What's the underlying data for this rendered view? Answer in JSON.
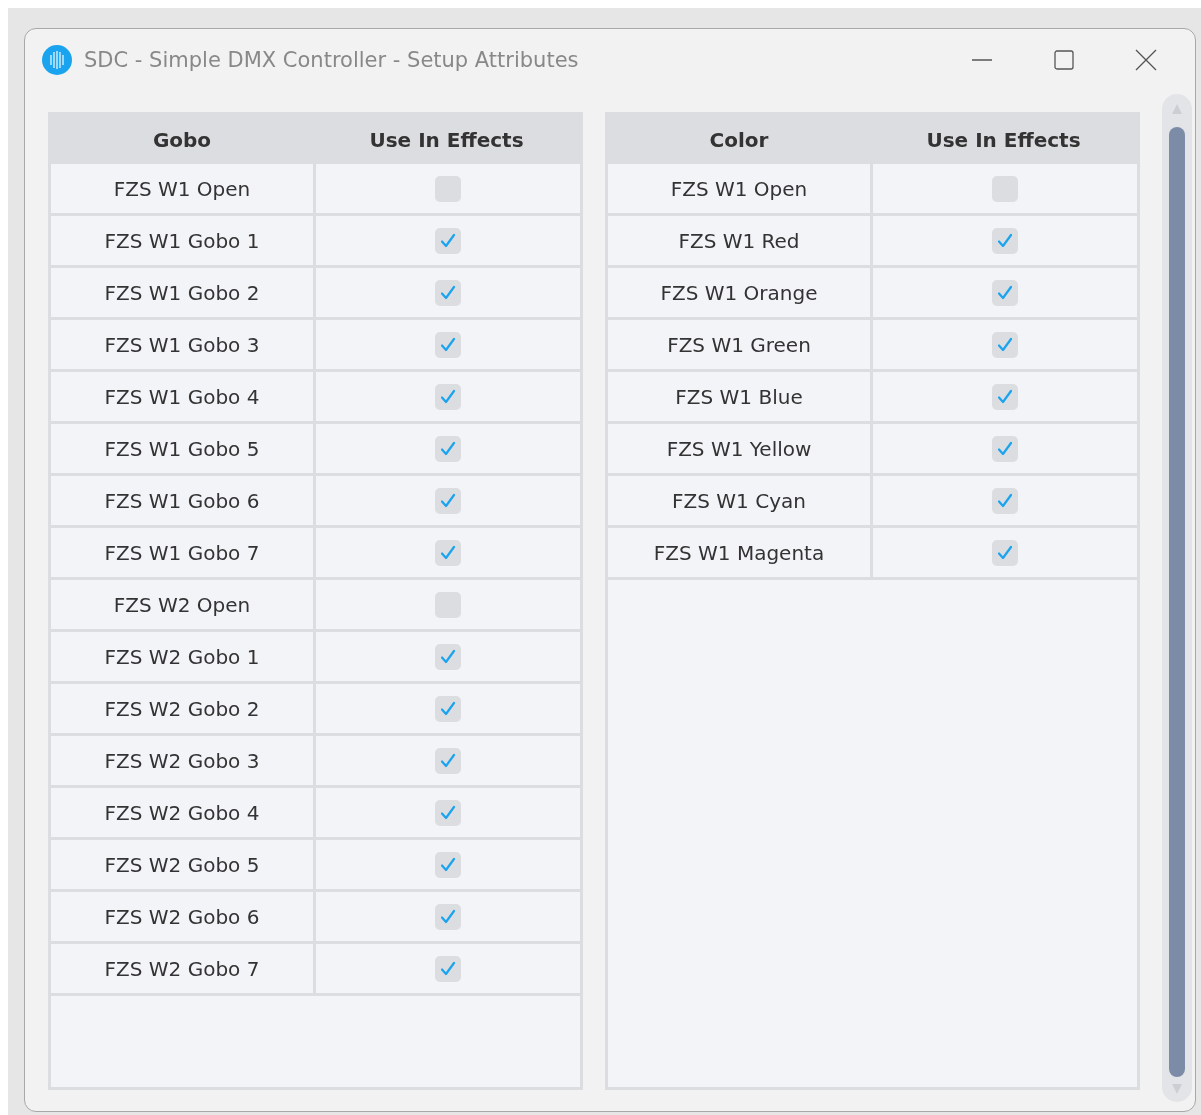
{
  "window": {
    "title": "SDC - Simple DMX Controller - Setup Attributes"
  },
  "tables": [
    {
      "columns": [
        "Gobo",
        "Use In Effects"
      ],
      "rows": [
        {
          "name": "FZS W1 Open",
          "checked": false
        },
        {
          "name": "FZS W1 Gobo 1",
          "checked": true
        },
        {
          "name": "FZS W1 Gobo 2",
          "checked": true
        },
        {
          "name": "FZS W1 Gobo 3",
          "checked": true
        },
        {
          "name": "FZS W1 Gobo 4",
          "checked": true
        },
        {
          "name": "FZS W1 Gobo 5",
          "checked": true
        },
        {
          "name": "FZS W1 Gobo 6",
          "checked": true
        },
        {
          "name": "FZS W1 Gobo 7",
          "checked": true
        },
        {
          "name": "FZS W2 Open",
          "checked": false
        },
        {
          "name": "FZS W2 Gobo 1",
          "checked": true
        },
        {
          "name": "FZS W2 Gobo 2",
          "checked": true
        },
        {
          "name": "FZS W2 Gobo 3",
          "checked": true
        },
        {
          "name": "FZS W2 Gobo 4",
          "checked": true
        },
        {
          "name": "FZS W2 Gobo 5",
          "checked": true
        },
        {
          "name": "FZS W2 Gobo 6",
          "checked": true
        },
        {
          "name": "FZS W2 Gobo 7",
          "checked": true
        }
      ]
    },
    {
      "columns": [
        "Color",
        "Use In Effects"
      ],
      "rows": [
        {
          "name": "FZS W1 Open",
          "checked": false
        },
        {
          "name": "FZS W1 Red",
          "checked": true
        },
        {
          "name": "FZS W1 Orange",
          "checked": true
        },
        {
          "name": "FZS W1 Green",
          "checked": true
        },
        {
          "name": "FZS W1 Blue",
          "checked": true
        },
        {
          "name": "FZS W1 Yellow",
          "checked": true
        },
        {
          "name": "FZS W1 Cyan",
          "checked": true
        },
        {
          "name": "FZS W1 Magenta",
          "checked": true
        }
      ]
    }
  ]
}
